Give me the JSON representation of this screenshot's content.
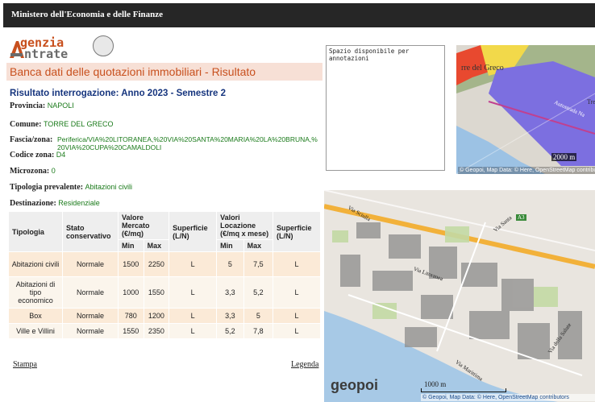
{
  "header": {
    "title": "Ministero dell'Economia e delle Finanze"
  },
  "logo": {
    "line1": "genzia",
    "line2": "ntrate"
  },
  "banner": {
    "title": "Banca dati delle quotazioni immobiliari - Risultato"
  },
  "result": {
    "title": "Risultato interrogazione: Anno 2023 - Semestre 2",
    "provincia_label": "Provincia:",
    "provincia": "NAPOLI",
    "comune_label": "Comune:",
    "comune": "TORRE DEL GRECO",
    "fascia_label": "Fascia/zona:",
    "fascia": "Periferica/VIA%20LITORANEA,%20VIA%20SANTA%20MARIA%20LA%20BRUNA,%20VIA%20CUPA%20CAMALDOLI",
    "codice_label": "Codice zona:",
    "codice": "D4",
    "microzona_label": "Microzona:",
    "microzona": "0",
    "tipologia_label": "Tipologia prevalente:",
    "tipologia": "Abitazioni civili",
    "destinazione_label": "Destinazione:",
    "destinazione": "Residenziale"
  },
  "table": {
    "headers": {
      "tipologia": "Tipologia",
      "stato": "Stato conservativo",
      "valore": "Valore Mercato (€/mq)",
      "superficie": "Superficie (L/N)",
      "locazione": "Valori Locazione (€/mq x mese)",
      "superficie2": "Superficie (L/N)",
      "min": "Min",
      "max": "Max"
    },
    "rows": [
      {
        "tipologia": "Abitazioni civili",
        "stato": "Normale",
        "vmin": "1500",
        "vmax": "2250",
        "sup": "L",
        "lmin": "5",
        "lmax": "7,5",
        "sup2": "L"
      },
      {
        "tipologia": "Abitazioni di tipo economico",
        "stato": "Normale",
        "vmin": "1000",
        "vmax": "1550",
        "sup": "L",
        "lmin": "3,3",
        "lmax": "5,2",
        "sup2": "L"
      },
      {
        "tipologia": "Box",
        "stato": "Normale",
        "vmin": "780",
        "vmax": "1200",
        "sup": "L",
        "lmin": "3,3",
        "lmax": "5",
        "sup2": "L"
      },
      {
        "tipologia": "Ville e Villini",
        "stato": "Normale",
        "vmin": "1550",
        "vmax": "2350",
        "sup": "L",
        "lmin": "5,2",
        "lmax": "7,8",
        "sup2": "L"
      }
    ]
  },
  "links": {
    "stampa": "Stampa",
    "legenda": "Legenda"
  },
  "annotations": {
    "text": "Spazio disponibile per annotazioni"
  },
  "map1": {
    "place_label": "rre del Greco",
    "road_label": "Autostrada Na",
    "scale": "2000 m",
    "attribution": "© Geopoi, Map Data: © Here, OpenStreetMap contributors",
    "edge_label": "Tre"
  },
  "map2": {
    "brand": "geopoi",
    "scale": "1000 m",
    "attribution": "© Geopoi, Map Data: © Here, OpenStreetMap contributors",
    "road_shield": "A3",
    "labels": [
      "Via Sciulla",
      "Via Marittima",
      "Via della Salute",
      "Via Litoranea",
      "Via Santa"
    ]
  },
  "colors": {
    "accent": "#c8501e",
    "link_green": "#1a7a1a",
    "title_blue": "#16357e"
  }
}
